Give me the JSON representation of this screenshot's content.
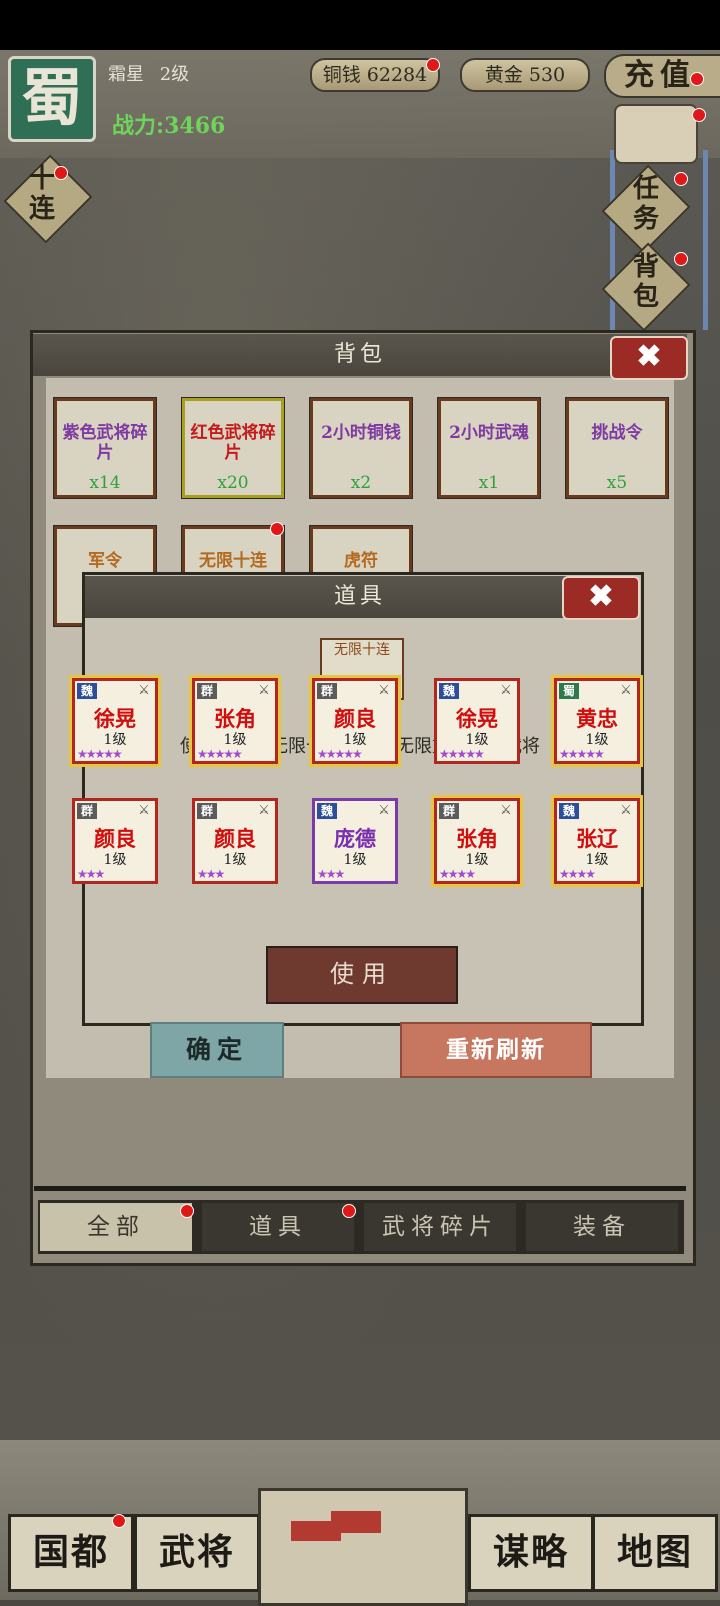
{
  "header": {
    "kingdom": "蜀",
    "player_name": "霜星",
    "player_level": "2级",
    "power": "战力:3466",
    "copper": "铜钱 62284",
    "gold": "黄金 530",
    "recharge": "充值"
  },
  "side": {
    "ten_draw": "十连",
    "task": "任务",
    "bag": "背包"
  },
  "backpack": {
    "title": "背包",
    "close_icon": "close-icon",
    "items": [
      {
        "name": "紫色武将碎片",
        "count": "x14"
      },
      {
        "name": "红色武将碎片",
        "count": "x20"
      },
      {
        "name": "2小时铜钱",
        "count": "x2"
      },
      {
        "name": "2小时武魂",
        "count": "x1"
      },
      {
        "name": "挑战令",
        "count": "x5"
      }
    ],
    "row2": [
      "军令",
      "无限十连",
      "虎符"
    ],
    "tabs": [
      "全部",
      "道具",
      "武将碎片",
      "装备"
    ]
  },
  "dialog": {
    "title": "道具",
    "item_name": "无限十连",
    "description": "使用后激活无限十连活动可无限重置招募武将",
    "use_label": "使用",
    "confirm_label": "确定",
    "refresh_label": "重新刷新"
  },
  "results": [
    {
      "faction": "魏",
      "name": "徐晃",
      "level": "1级",
      "stars": "★★★★★",
      "gold": true,
      "purple": false
    },
    {
      "faction": "群",
      "name": "张角",
      "level": "1级",
      "stars": "★★★★★",
      "gold": true,
      "purple": false
    },
    {
      "faction": "群",
      "name": "颜良",
      "level": "1级",
      "stars": "★★★★★",
      "gold": true,
      "purple": false
    },
    {
      "faction": "魏",
      "name": "徐晃",
      "level": "1级",
      "stars": "★★★★★",
      "gold": false,
      "purple": false
    },
    {
      "faction": "蜀",
      "name": "黄忠",
      "level": "1级",
      "stars": "★★★★★",
      "gold": true,
      "purple": false
    },
    {
      "faction": "群",
      "name": "颜良",
      "level": "1级",
      "stars": "★★★",
      "gold": false,
      "purple": false
    },
    {
      "faction": "群",
      "name": "颜良",
      "level": "1级",
      "stars": "★★★",
      "gold": false,
      "purple": false
    },
    {
      "faction": "魏",
      "name": "庞德",
      "level": "1级",
      "stars": "★★★",
      "gold": false,
      "purple": true
    },
    {
      "faction": "群",
      "name": "张角",
      "level": "1级",
      "stars": "★★★★",
      "gold": true,
      "purple": false
    },
    {
      "faction": "魏",
      "name": "张辽",
      "level": "1级",
      "stars": "★★★★",
      "gold": true,
      "purple": false
    }
  ],
  "nav": {
    "capital": "国都",
    "generals": "武将",
    "strategy": "谋略",
    "map": "地图"
  }
}
